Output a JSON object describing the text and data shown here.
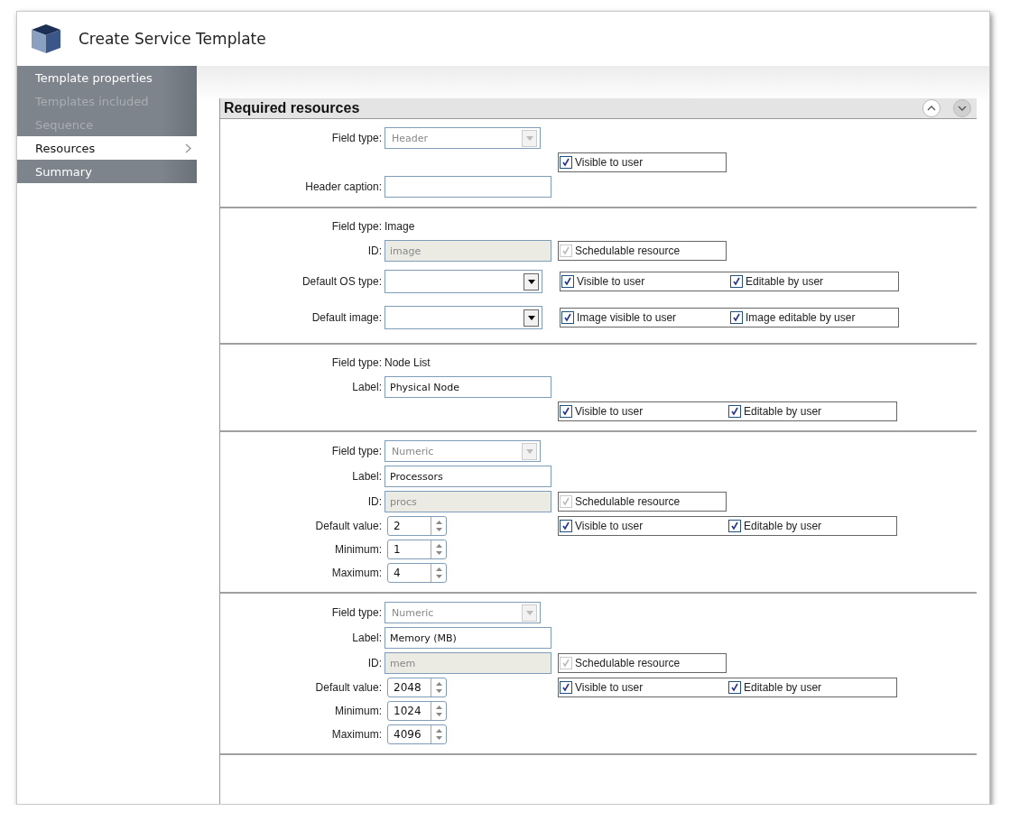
{
  "window": {
    "title": "Create Service Template"
  },
  "sidebar": {
    "items": [
      {
        "label": "Template properties",
        "selected": false,
        "disabled": false
      },
      {
        "label": "Templates included",
        "selected": false,
        "disabled": true
      },
      {
        "label": "Sequence",
        "selected": false,
        "disabled": true
      },
      {
        "label": "Resources",
        "selected": true,
        "disabled": false
      },
      {
        "label": "Summary",
        "selected": false,
        "disabled": false
      }
    ]
  },
  "panel": {
    "title": "Required resources",
    "sections": [
      {
        "rows": [
          {
            "field": {
              "label": "Field type:",
              "kind": "locked_select",
              "value": "Header"
            }
          },
          {
            "options": [
              {
                "label": "Visible to user",
                "checked": true,
                "disabled": false
              }
            ]
          },
          {
            "field": {
              "label": "Header caption:",
              "kind": "text"
            }
          }
        ]
      },
      {
        "rows": [
          {
            "field": {
              "label": "Field type:",
              "kind": "static",
              "value": "Image"
            }
          },
          {
            "field": {
              "label": "ID:",
              "kind": "readonly",
              "value": "image"
            },
            "options": [
              {
                "label": "Schedulable resource",
                "checked": true,
                "disabled": true
              }
            ]
          },
          {
            "field": {
              "label": "Default OS type:",
              "kind": "select"
            },
            "options": [
              {
                "label": "Visible to user",
                "checked": true,
                "disabled": false
              },
              {
                "label": "Editable by user",
                "checked": true,
                "disabled": false
              }
            ]
          },
          {
            "field": {
              "label": "Default image:",
              "kind": "select"
            },
            "options": [
              {
                "label": "Image visible to user",
                "checked": true,
                "disabled": false
              },
              {
                "label": "Image editable by user",
                "checked": true,
                "disabled": false
              }
            ]
          }
        ]
      },
      {
        "rows": [
          {
            "field": {
              "label": "Field type:",
              "kind": "static",
              "value": "Node List"
            }
          },
          {
            "field": {
              "label": "Label:",
              "kind": "text",
              "value": "Physical Node"
            }
          },
          {
            "options": [
              {
                "label": "Visible to user",
                "checked": true,
                "disabled": false
              },
              {
                "label": "Editable by user",
                "checked": true,
                "disabled": false
              }
            ]
          }
        ]
      },
      {
        "rows": [
          {
            "field": {
              "label": "Field type:",
              "kind": "locked_select",
              "value": "Numeric"
            }
          },
          {
            "field": {
              "label": "Label:",
              "kind": "text",
              "value": "Processors"
            }
          },
          {
            "field": {
              "label": "ID:",
              "kind": "readonly",
              "value": "procs"
            },
            "options": [
              {
                "label": "Schedulable resource",
                "checked": true,
                "disabled": true
              }
            ]
          },
          {
            "field": {
              "label": "Default value:",
              "kind": "spinner",
              "value": "2"
            },
            "options": [
              {
                "label": "Visible to user",
                "checked": true,
                "disabled": false
              },
              {
                "label": "Editable by user",
                "checked": true,
                "disabled": false
              }
            ]
          },
          {
            "field": {
              "label": "Minimum:",
              "kind": "spinner",
              "value": "1"
            }
          },
          {
            "field": {
              "label": "Maximum:",
              "kind": "spinner",
              "value": "4"
            }
          }
        ]
      },
      {
        "rows": [
          {
            "field": {
              "label": "Field type:",
              "kind": "locked_select",
              "value": "Numeric"
            }
          },
          {
            "field": {
              "label": "Label:",
              "kind": "text",
              "value": "Memory (MB)"
            }
          },
          {
            "field": {
              "label": "ID:",
              "kind": "readonly",
              "value": "mem"
            },
            "options": [
              {
                "label": "Schedulable resource",
                "checked": true,
                "disabled": true
              }
            ]
          },
          {
            "field": {
              "label": "Default value:",
              "kind": "spinner",
              "value": "2048"
            },
            "options": [
              {
                "label": "Visible to user",
                "checked": true,
                "disabled": false
              },
              {
                "label": "Editable by user",
                "checked": true,
                "disabled": false
              }
            ]
          },
          {
            "field": {
              "label": "Minimum:",
              "kind": "spinner",
              "value": "1024"
            }
          },
          {
            "field": {
              "label": "Maximum:",
              "kind": "spinner",
              "value": "4096"
            }
          }
        ]
      }
    ]
  }
}
